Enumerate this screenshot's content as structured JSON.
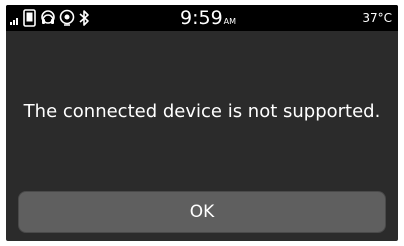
{
  "status_bar": {
    "time": "9:59",
    "time_suffix": "AM",
    "temperature": "37°C",
    "icons": [
      "signal-icon",
      "phone-icon",
      "headset-icon",
      "media-icon",
      "bluetooth-icon"
    ]
  },
  "dialog": {
    "message": "The connected device is not supported.",
    "ok_label": "OK"
  },
  "colors": {
    "screen_background": "#2b2b2b",
    "status_bar_background": "#000000",
    "button_background": "#5f5f5f",
    "text": "#ffffff"
  }
}
